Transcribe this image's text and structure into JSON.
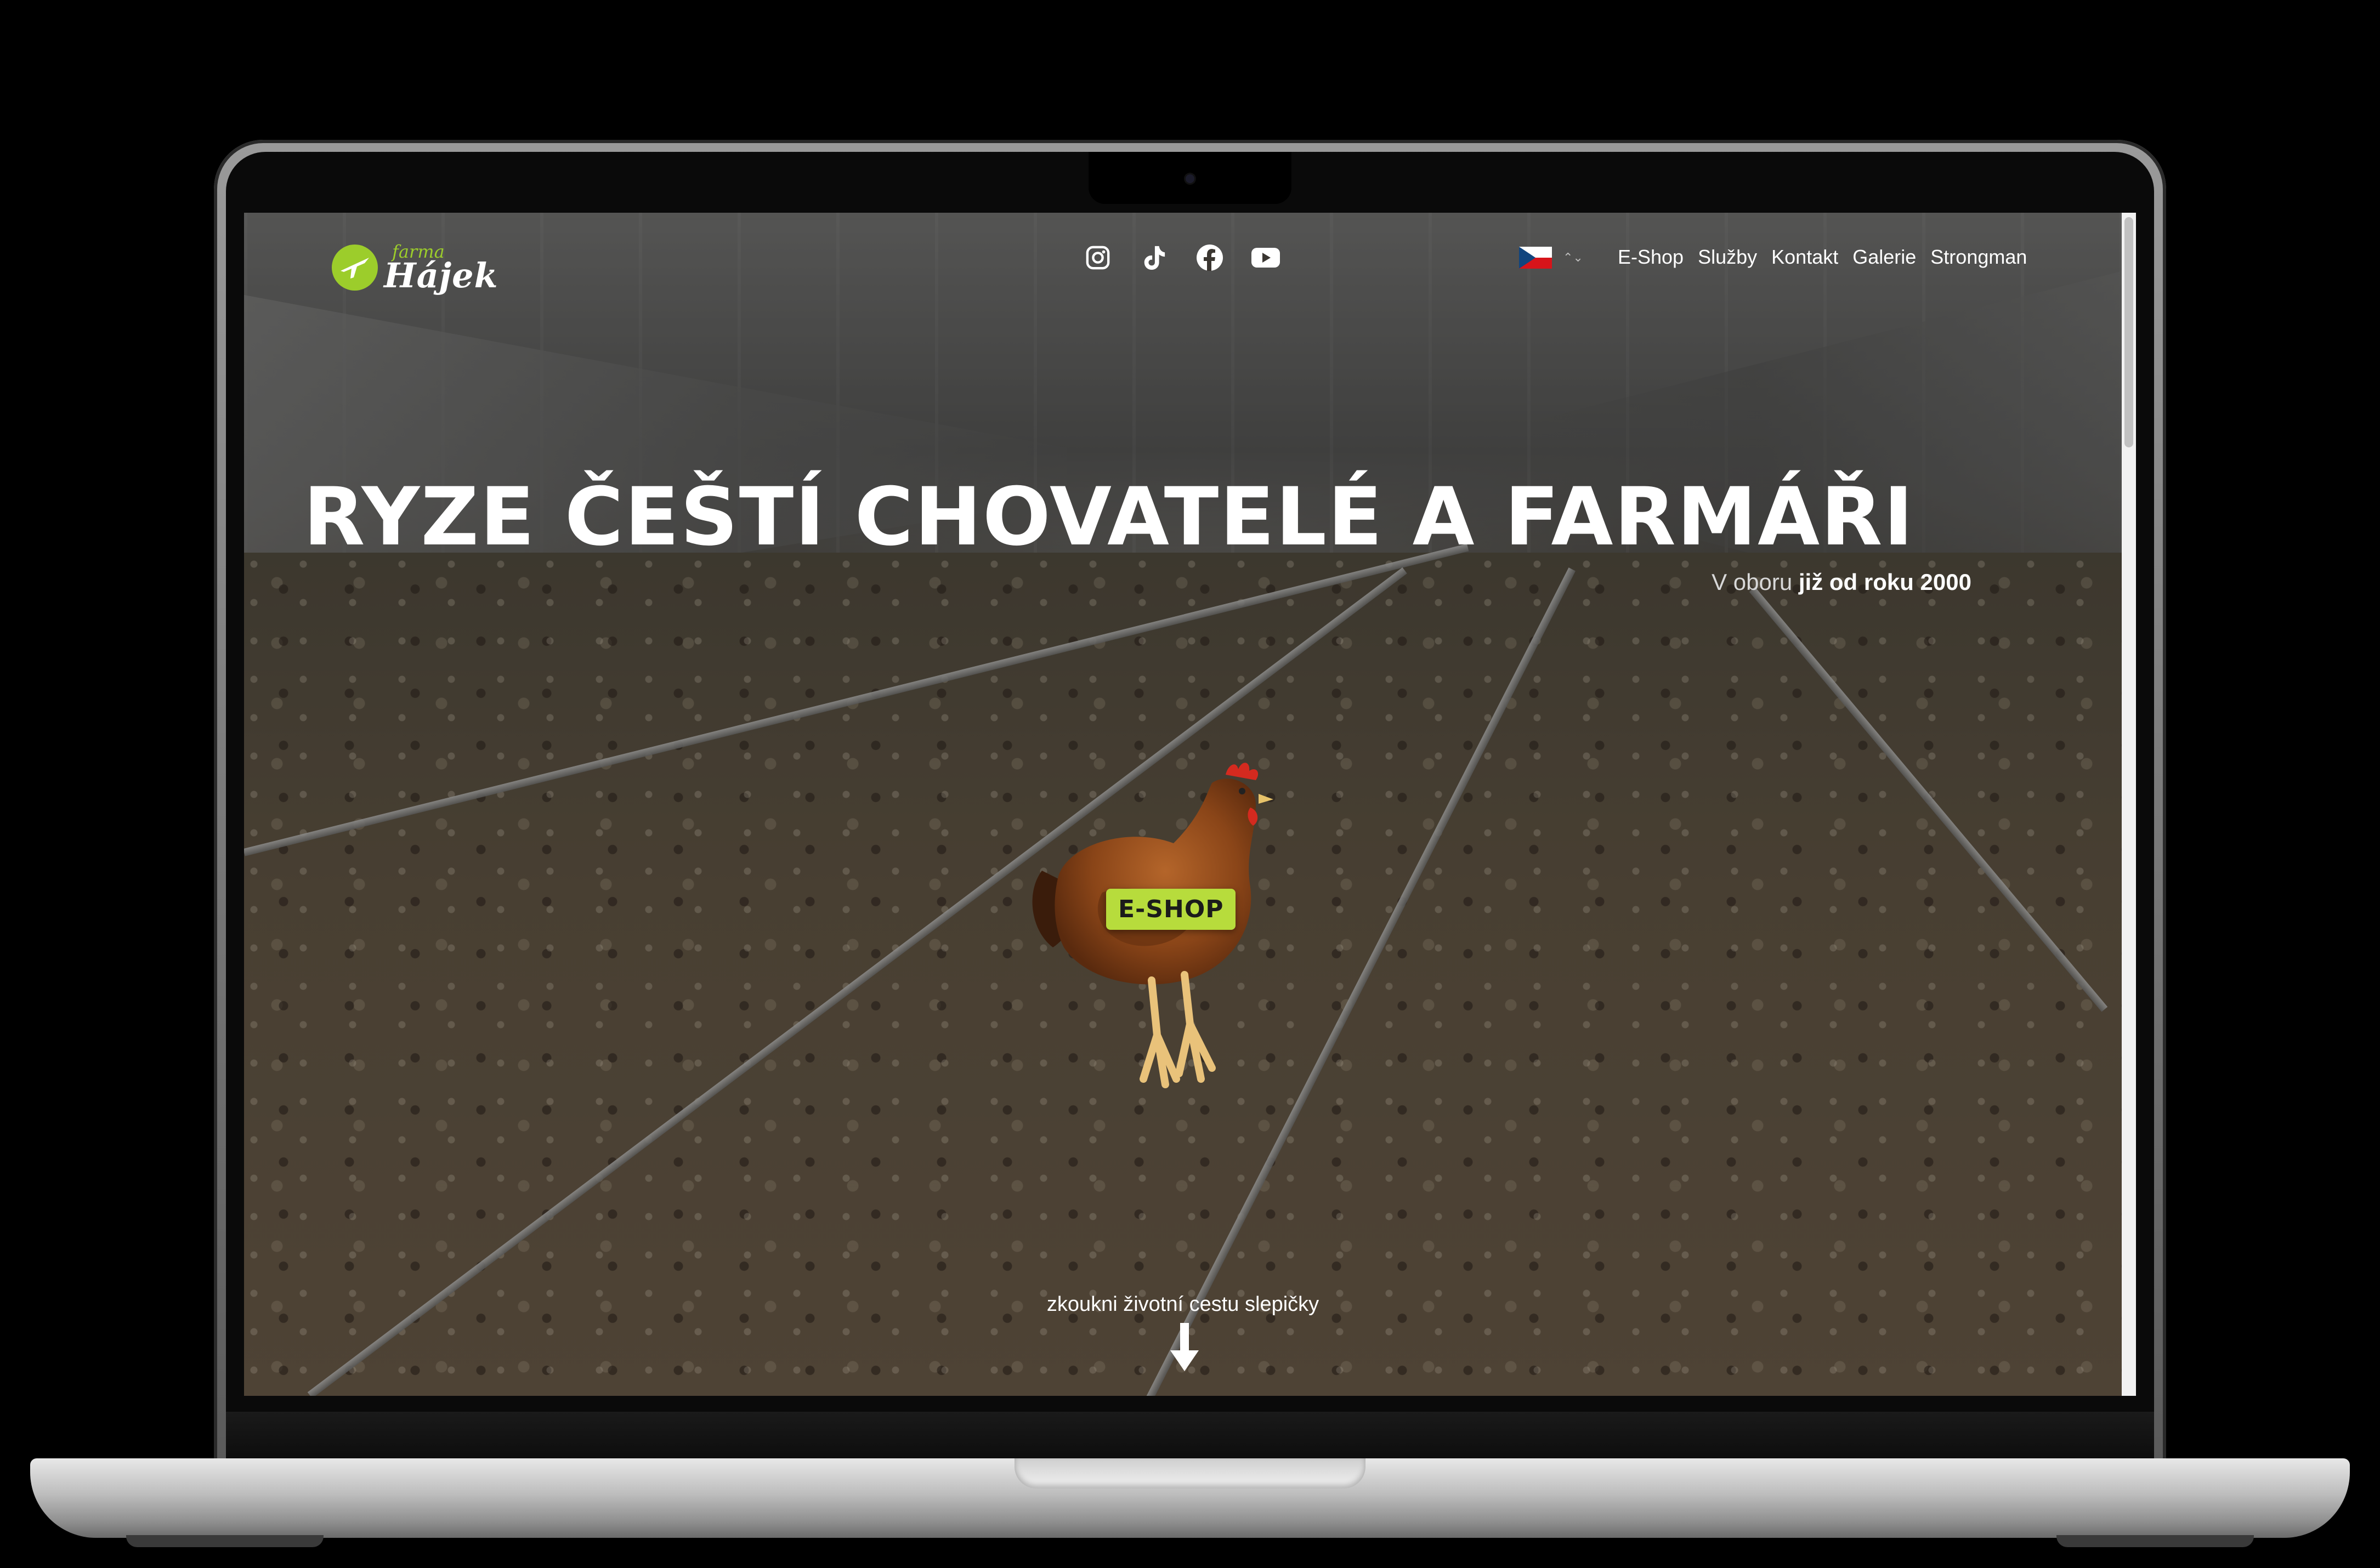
{
  "header": {
    "logo": {
      "small_text": "farma",
      "big_text": "Hájek"
    },
    "socials": [
      {
        "name": "instagram-icon"
      },
      {
        "name": "tiktok-icon"
      },
      {
        "name": "facebook-icon"
      },
      {
        "name": "youtube-icon"
      }
    ],
    "language": {
      "flag": "cz-flag-icon",
      "caret": "⌃⌄"
    },
    "nav": {
      "items": [
        "E-Shop",
        "Služby",
        "Kontakt",
        "Galerie",
        "Strongman"
      ]
    }
  },
  "hero": {
    "title": "RYZE ČEŠTÍ CHOVATELÉ A FARMÁŘI",
    "subtitle_prefix": "V oboru ",
    "subtitle_bold": "již od roku 2000",
    "eshop_button": "E-SHOP",
    "scroll_hint": "zkoukni životní cestu slepičky"
  },
  "colors": {
    "accent_green": "#b7dc3c",
    "logo_green": "#9ccd2b",
    "text": "#ffffff"
  }
}
